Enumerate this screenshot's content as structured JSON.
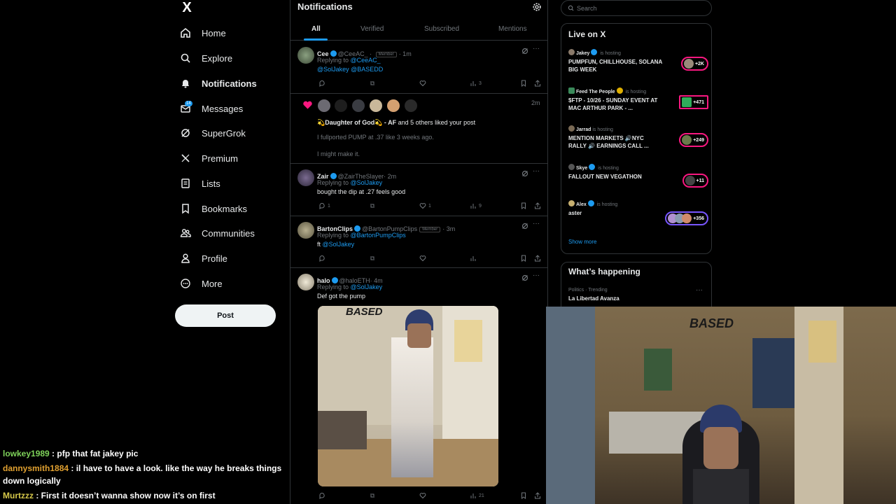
{
  "sidebar": {
    "logo": "X",
    "items": [
      {
        "label": "Home",
        "icon": "home-icon"
      },
      {
        "label": "Explore",
        "icon": "search-icon"
      },
      {
        "label": "Notifications",
        "icon": "bell-icon"
      },
      {
        "label": "Messages",
        "icon": "envelope-icon",
        "badge": "14"
      },
      {
        "label": "SuperGrok",
        "icon": "grok-icon"
      },
      {
        "label": "Premium",
        "icon": "x-icon"
      },
      {
        "label": "Lists",
        "icon": "list-icon"
      },
      {
        "label": "Bookmarks",
        "icon": "bookmark-icon"
      },
      {
        "label": "Communities",
        "icon": "people-icon"
      },
      {
        "label": "Profile",
        "icon": "person-icon"
      },
      {
        "label": "More",
        "icon": "more-circle-icon"
      }
    ],
    "post_button": "Post"
  },
  "feed": {
    "title": "Notifications",
    "tabs": [
      "All",
      "Verified",
      "Subscribed",
      "Mentions"
    ],
    "posts": [
      {
        "name": "Cee",
        "handle": "@CeeAC_",
        "member": "Member",
        "time": "· 1m",
        "replying": "Replying to ",
        "reply_to": "@CeeAC_",
        "reply_to2": "@SolJakey @BASEDD",
        "text": "",
        "likes": "",
        "replies": "",
        "views": "3"
      },
      {
        "name": "Zair",
        "handle": "@ZairTheSlayer",
        "time": "· 2m",
        "replying": "Replying to ",
        "reply_to": "@SolJakey",
        "text": "bought the dip at .27 feels good",
        "replies": "1",
        "likes": "1",
        "views": "9"
      },
      {
        "name": "BartonClips",
        "handle": "@BartonPumpClips",
        "member": "Member",
        "time": "· 3m",
        "replying": "Replying to ",
        "reply_to": "@BartonPumpClips",
        "text_prefix": "ft ",
        "text_link": "@SolJakey"
      },
      {
        "name": "halo",
        "handle": "@haloETH",
        "time": "· 4m",
        "replying": "Replying to ",
        "reply_to": "@SolJakey",
        "text": "Def got the pump",
        "views": "21"
      }
    ],
    "like_notice": {
      "time": "2m",
      "name": "💫Daughter of God💫 - AF",
      "rest": " and 5 others liked your post",
      "line1": "I fullported PUMP at .37 like 3 weeks ago.",
      "line2": "I might make it."
    }
  },
  "search": {
    "placeholder": "Search"
  },
  "live": {
    "title": "Live on X",
    "hosting": "is hosting",
    "items": [
      {
        "host": "Jakey",
        "title": "PUMPFUN, CHILLHOUSE, SOLANA BIG WEEK",
        "count": "+2K"
      },
      {
        "host": "Feed The People",
        "title": "$FTP - 10/26 - SUNDAY EVENT AT MAC ARTHUR PARK - ...",
        "count": "+471"
      },
      {
        "host": "Jarrad",
        "title": "MENTION MARKETS 🔊NYC RALLY 🔊 EARNINGS CALL ...",
        "count": "+249"
      },
      {
        "host": "Skye",
        "title": "FALLOUT NEW VEGATHON",
        "count": "+11"
      },
      {
        "host": "Alex",
        "title": "aster",
        "count": "+356"
      }
    ],
    "show_more": "Show more"
  },
  "happening": {
    "title": "What’s happening",
    "category": "Politics · Trending",
    "topic": "La Libertad Avanza"
  },
  "chat": [
    {
      "user": "lowkey1989",
      "color": "#7fd35a",
      "msg": " : pfp that fat jakey pic"
    },
    {
      "user": "dannysmith1884",
      "color": "#e0a030",
      "msg": " : il have to have a look. like the way he breaks things down logically"
    },
    {
      "user": "Murtzzz",
      "color": "#d6c84a",
      "msg": " : First it doesn’t wanna show now it’s on first"
    }
  ],
  "image_text": {
    "sign": "BASED"
  }
}
